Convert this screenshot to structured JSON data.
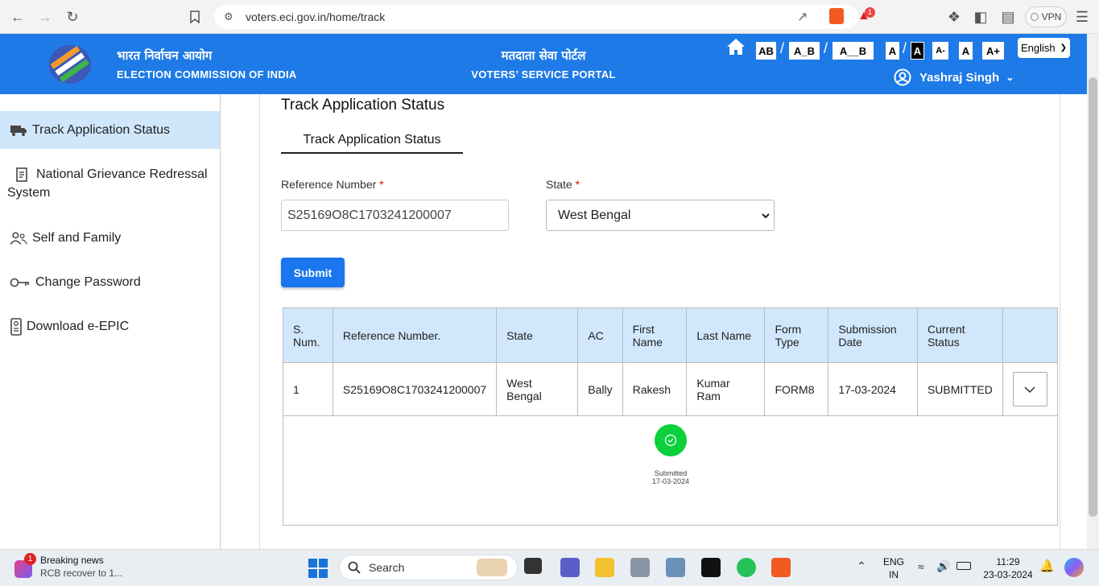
{
  "browser": {
    "url": "voters.eci.gov.in/home/track",
    "vpn_label": "VPN",
    "notification_count": "1"
  },
  "header": {
    "org_hindi": "भारत निर्वाचन आयोग",
    "org_english": "ELECTION COMMISSION OF INDIA",
    "portal_hindi": "मतदाता सेवा पोर्टल",
    "portal_english": "VOTERS’ SERVICE PORTAL",
    "spacing_buttons": [
      "AB",
      "A_B",
      "A__B"
    ],
    "contrast_buttons": [
      "A",
      "A"
    ],
    "font_buttons": [
      "A-",
      "A",
      "A+"
    ],
    "language": "English",
    "user_name": "Yashraj Singh"
  },
  "sidebar": {
    "items": [
      {
        "label": "Track Application Status",
        "icon": "truck-icon"
      },
      {
        "label": "National Grievance Redressal System",
        "icon": "document-icon"
      },
      {
        "label": "Self and Family",
        "icon": "family-icon"
      },
      {
        "label": "Change Password",
        "icon": "key-icon"
      },
      {
        "label": "Download e-EPIC",
        "icon": "id-card-icon"
      }
    ]
  },
  "main": {
    "title": "Track Application Status",
    "tab_label": "Track Application Status",
    "reference_label": "Reference Number",
    "state_label": "State",
    "required_mark": "*",
    "reference_value": "S25169O8C1703241200007",
    "state_value": "West Bengal",
    "submit_label": "Submit"
  },
  "table": {
    "headers": [
      "S. Num.",
      "Reference Number.",
      "State",
      "AC",
      "First Name",
      "Last Name",
      "Form Type",
      "Submission Date",
      "Current Status",
      ""
    ],
    "rows": [
      [
        "1",
        "S25169O8C1703241200007",
        "West Bengal",
        "Bally",
        "Rakesh",
        "Kumar Ram",
        "FORM8",
        "17-03-2024",
        "SUBMITTED"
      ]
    ],
    "stage_label": "Submitted",
    "stage_date": "17-03-2024"
  },
  "taskbar": {
    "news_title": "Breaking news",
    "news_subtitle": "RCB recover to 1...",
    "news_badge": "1",
    "search_label": "Search",
    "lang_line1": "ENG",
    "lang_line2": "IN",
    "time": "11:29",
    "date": "23-03-2024"
  },
  "colors": {
    "header_blue": "#1e7ae6",
    "table_header": "#d1e7fb",
    "success_green": "#0bd13c",
    "submit_blue": "#1976ee"
  }
}
